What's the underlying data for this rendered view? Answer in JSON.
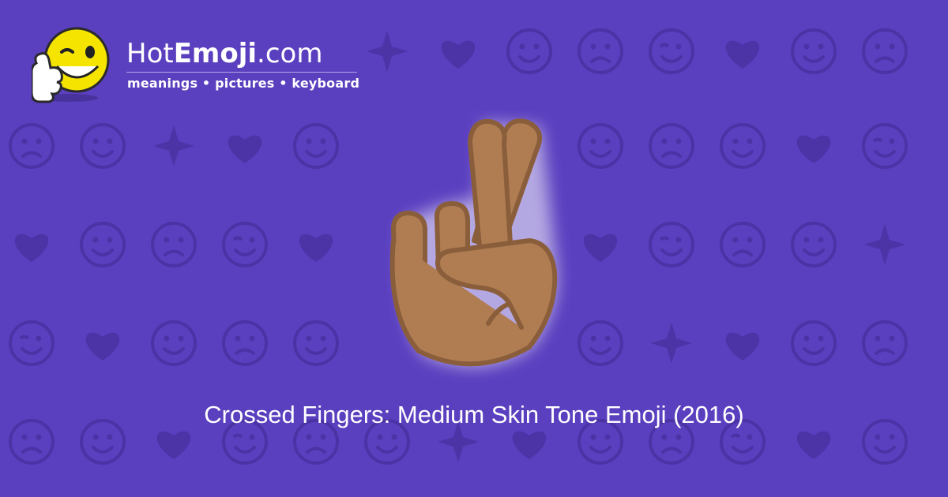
{
  "site": {
    "brand_prefix": "Hot",
    "brand_bold": "Emoji",
    "brand_suffix": ".com",
    "tagline": "meanings • pictures • keyboard"
  },
  "emoji": {
    "title": "Crossed Fingers: Medium Skin Tone Emoji (2016)",
    "icon": "crossed-fingers-medium-skin-tone"
  },
  "colors": {
    "background": "#5a3fbf",
    "pattern": "#4a32a3",
    "skin": "#b07d52",
    "skin_outline": "#8a5e3b",
    "logo_face": "#f5e400"
  }
}
